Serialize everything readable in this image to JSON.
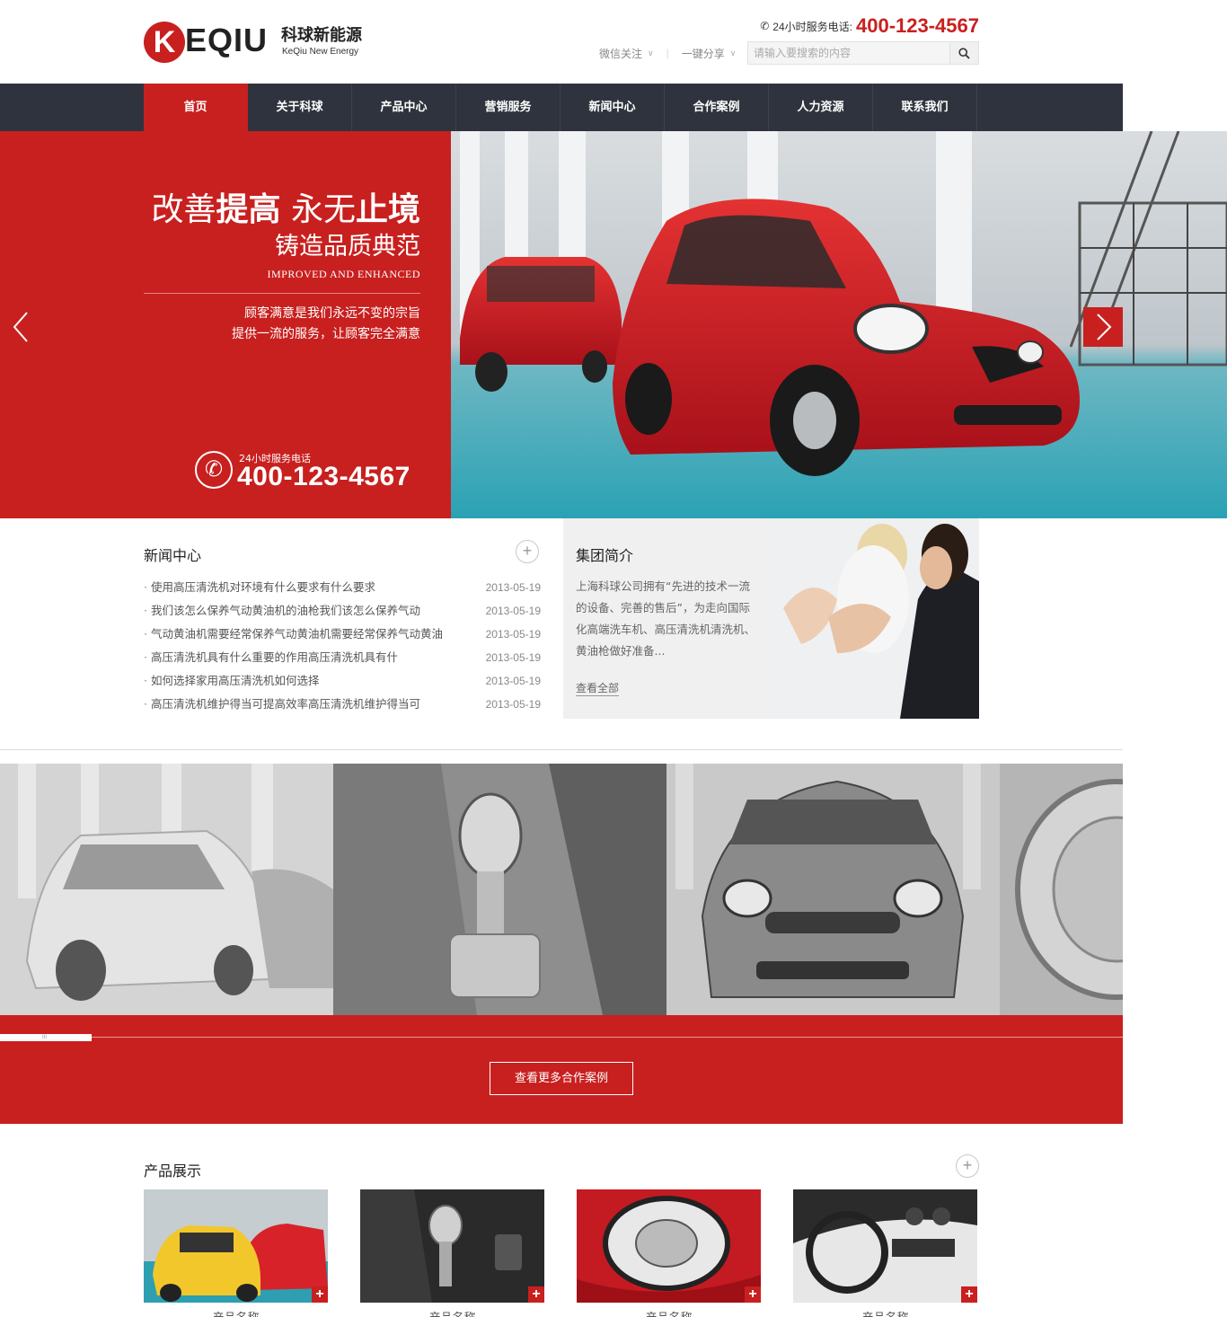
{
  "header": {
    "logo_letters": "KEQIU",
    "logo_k": "K",
    "logo_rest": "EQIU",
    "logo_cn": "科球新能源",
    "logo_en": "KeQiu New Energy",
    "hotline_label": "24小时服务电话:",
    "hotline_number": "400-123-4567",
    "wechat_label": "微信关注",
    "share_label": "一键分享",
    "search_placeholder": "请输入要搜索的内容"
  },
  "nav": {
    "items": [
      {
        "label": "首页"
      },
      {
        "label": "关于科球"
      },
      {
        "label": "产品中心"
      },
      {
        "label": "营销服务"
      },
      {
        "label": "新闻中心"
      },
      {
        "label": "合作案例"
      },
      {
        "label": "人力资源"
      },
      {
        "label": "联系我们"
      }
    ],
    "active_index": 0
  },
  "banner": {
    "slogan_a1": "改善",
    "slogan_b1": "提高",
    "slogan_a2": " 永无",
    "slogan_b2": "止境",
    "slogan2": "铸造品质典范",
    "slogan_en": "IMPROVED AND ENHANCED",
    "sub1": "顾客满意是我们永远不变的宗旨",
    "sub2": "提供一流的服务，让顾客完全满意",
    "phone_label": "24小时服务电话",
    "phone_number": "400-123-4567"
  },
  "news": {
    "title": "新闻中心",
    "items": [
      {
        "title": "使用高压清洗机对环境有什么要求有什么要求",
        "date": "2013-05-19"
      },
      {
        "title": "我们该怎么保养气动黄油机的油枪我们该怎么保养气动",
        "date": "2013-05-19"
      },
      {
        "title": "气动黄油机需要经常保养气动黄油机需要经常保养气动黄油",
        "date": "2013-05-19"
      },
      {
        "title": "高压清洗机具有什么重要的作用高压清洗机具有什",
        "date": "2013-05-19"
      },
      {
        "title": "如何选择家用高压清洗机如何选择",
        "date": "2013-05-19"
      },
      {
        "title": "高压清洗机维护得当可提高效率高压清洗机维护得当可",
        "date": "2013-05-19"
      }
    ]
  },
  "about": {
    "title": "集团简介",
    "text": "上海科球公司拥有“先进的技术一流的设备、完善的售后”，为走向国际化高端洗车机、高压清洗机清洗机、黄油枪做好准备...",
    "more": "查看全部"
  },
  "cases": {
    "button": "查看更多合作案例",
    "scroll_glyph": "III"
  },
  "products": {
    "title": "产品展示",
    "plus": "+",
    "items": [
      {
        "name": "产品名称"
      },
      {
        "name": "产品名称"
      },
      {
        "name": "产品名称"
      },
      {
        "name": "产品名称"
      }
    ]
  },
  "colors": {
    "brand_red": "#c8201f",
    "nav_dark": "#2e333d"
  },
  "icons": [
    "phone-icon",
    "chevron-down-icon",
    "search-icon",
    "arrow-left-icon",
    "arrow-right-icon",
    "plus-circle-icon",
    "plus-icon"
  ]
}
